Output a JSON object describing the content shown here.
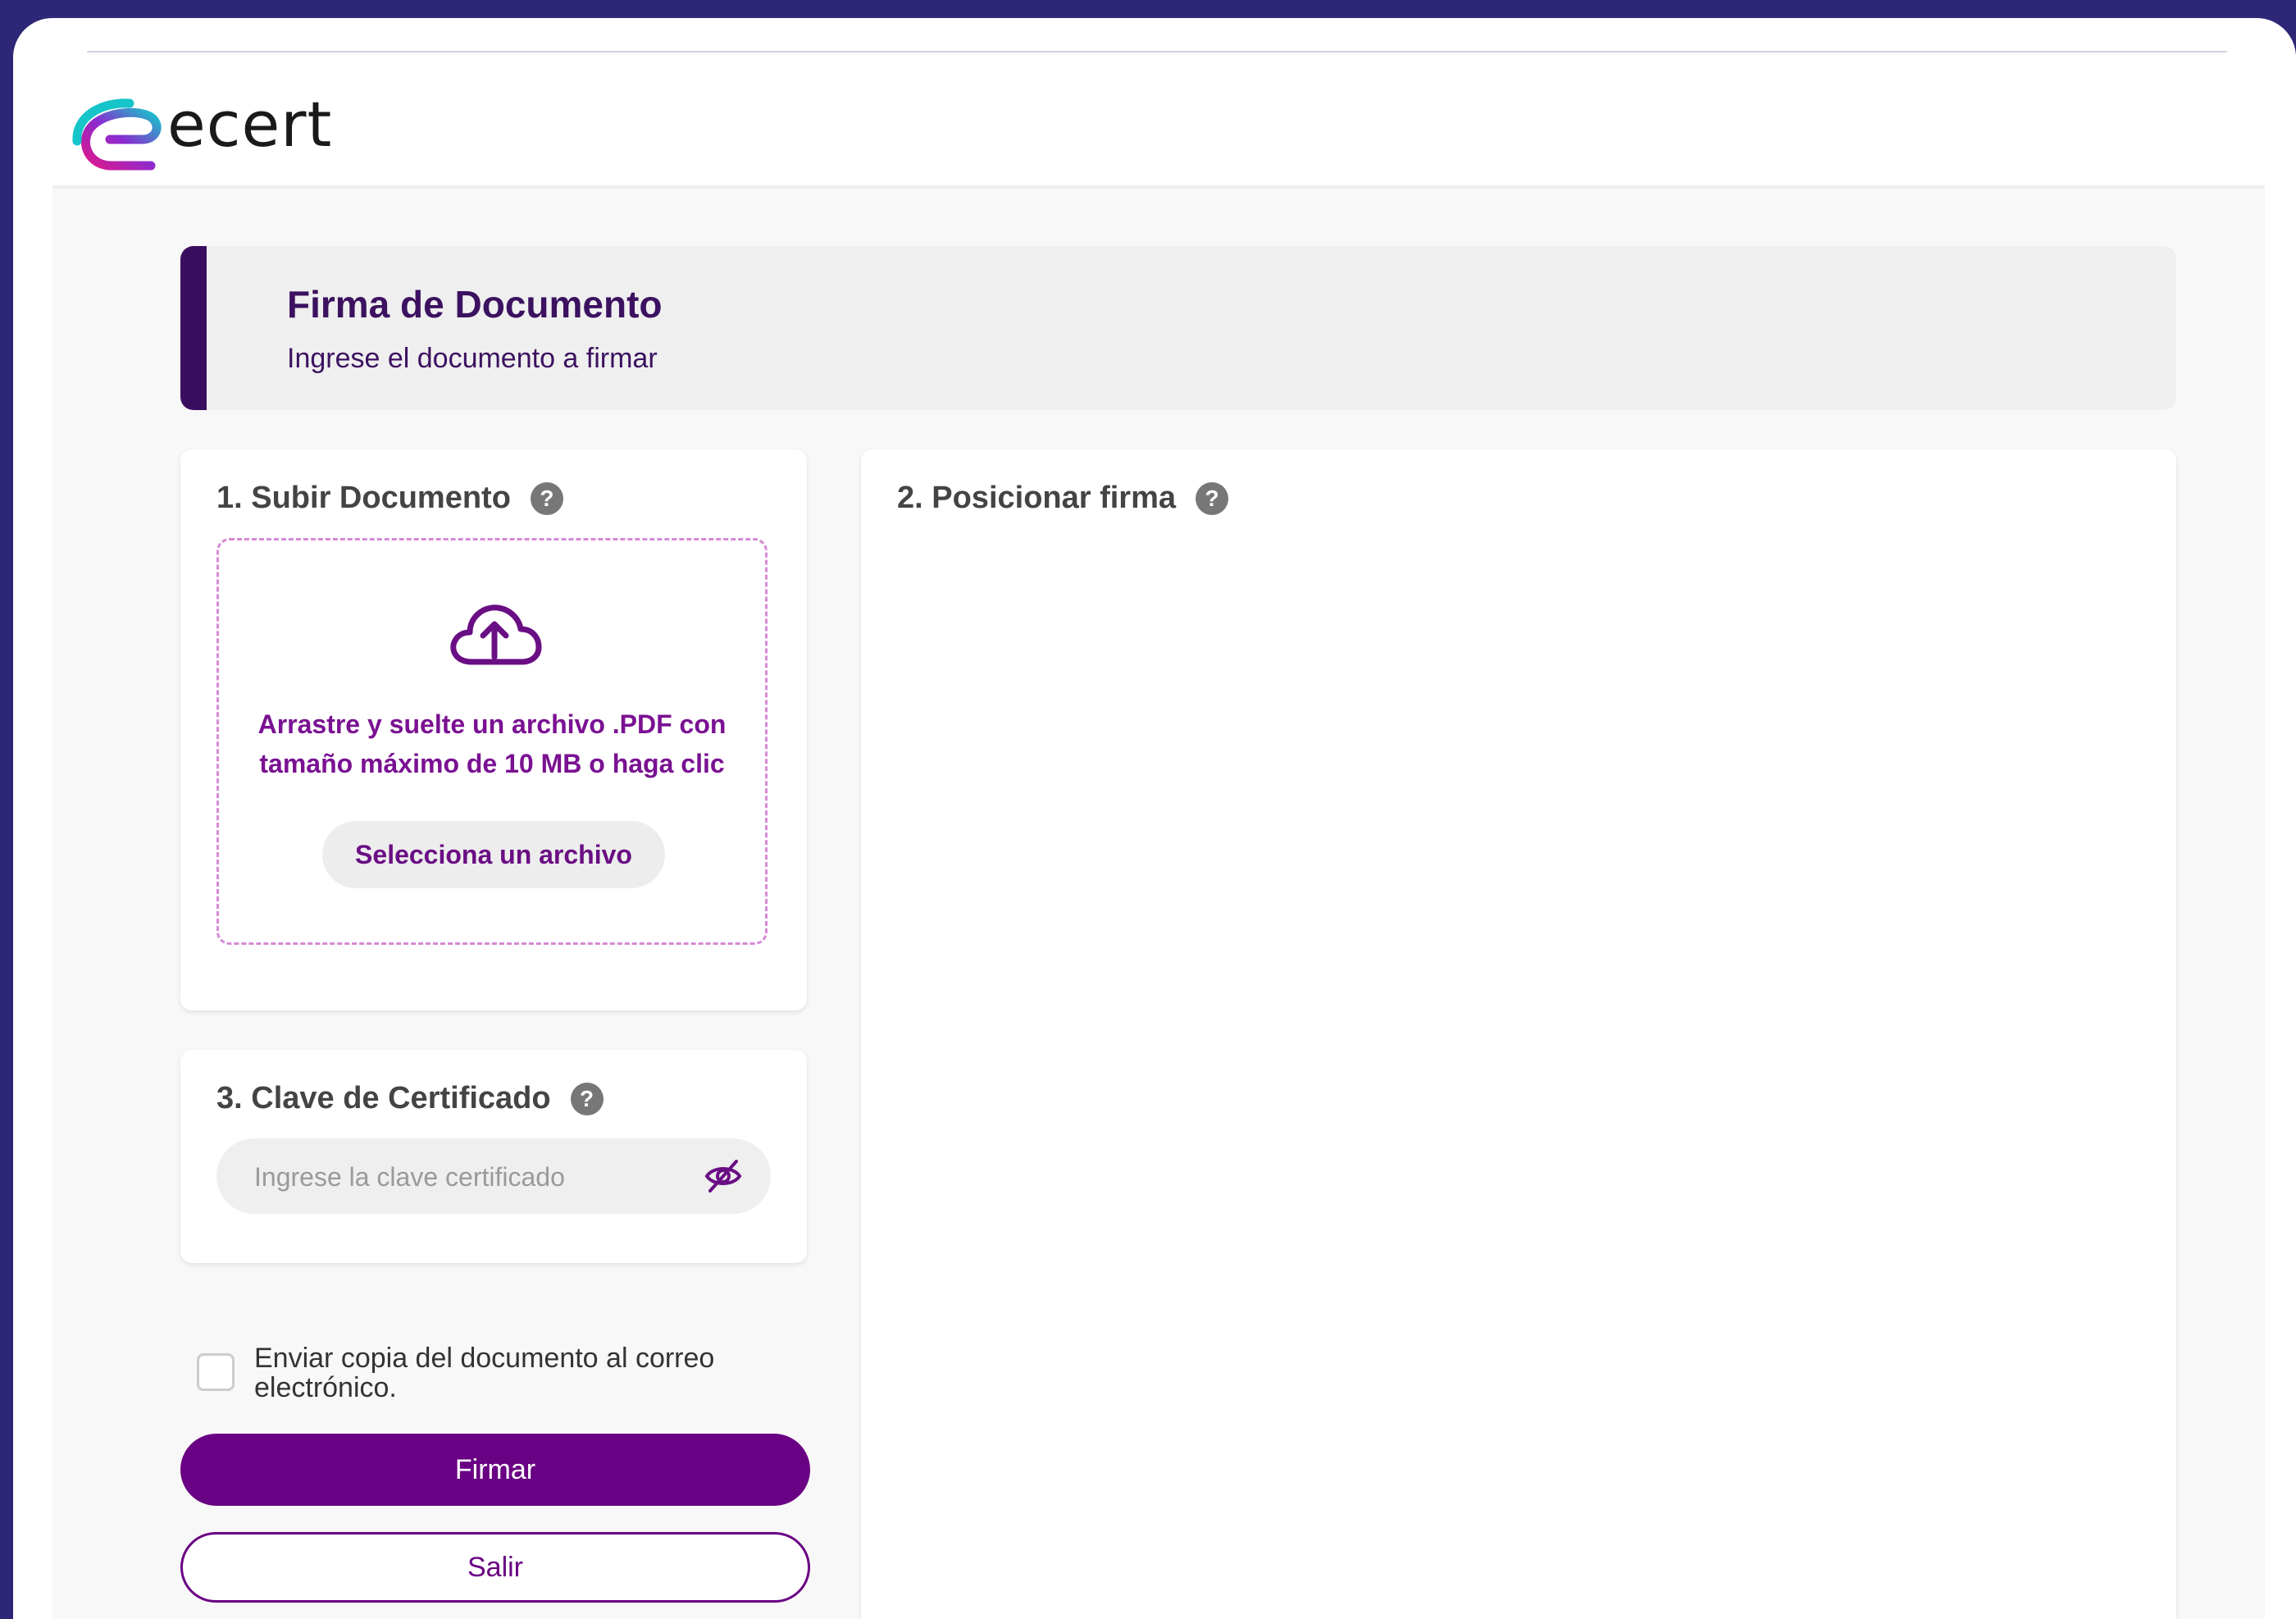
{
  "app": {
    "logo_text": "ecert"
  },
  "banner": {
    "title": "Firma de Documento",
    "subtitle": "Ingrese el documento a firmar"
  },
  "upload": {
    "title": "1. Subir Documento",
    "help": "?",
    "drop_text": "Arrastre y suelte un archivo .PDF con tamaño máximo de 10 MB o haga clic",
    "select_label": "Selecciona un archivo"
  },
  "position": {
    "title": "2. Posicionar firma",
    "help": "?"
  },
  "password": {
    "title": "3. Clave de Certificado",
    "help": "?",
    "value": "",
    "placeholder": "Ingrese la clave certificado"
  },
  "email_copy": {
    "label": "Enviar copia del documento al correo electrónico.",
    "checked": false
  },
  "actions": {
    "sign_label": "Firmar",
    "exit_label": "Salir"
  },
  "colors": {
    "primary": "#6a0083",
    "banner_accent": "#3a0e5e",
    "dropzone_border": "#d68ad6",
    "background": "#2e2676"
  },
  "icons": [
    "help-icon",
    "cloud-upload-icon",
    "eye-off-icon",
    "logo-icon"
  ]
}
